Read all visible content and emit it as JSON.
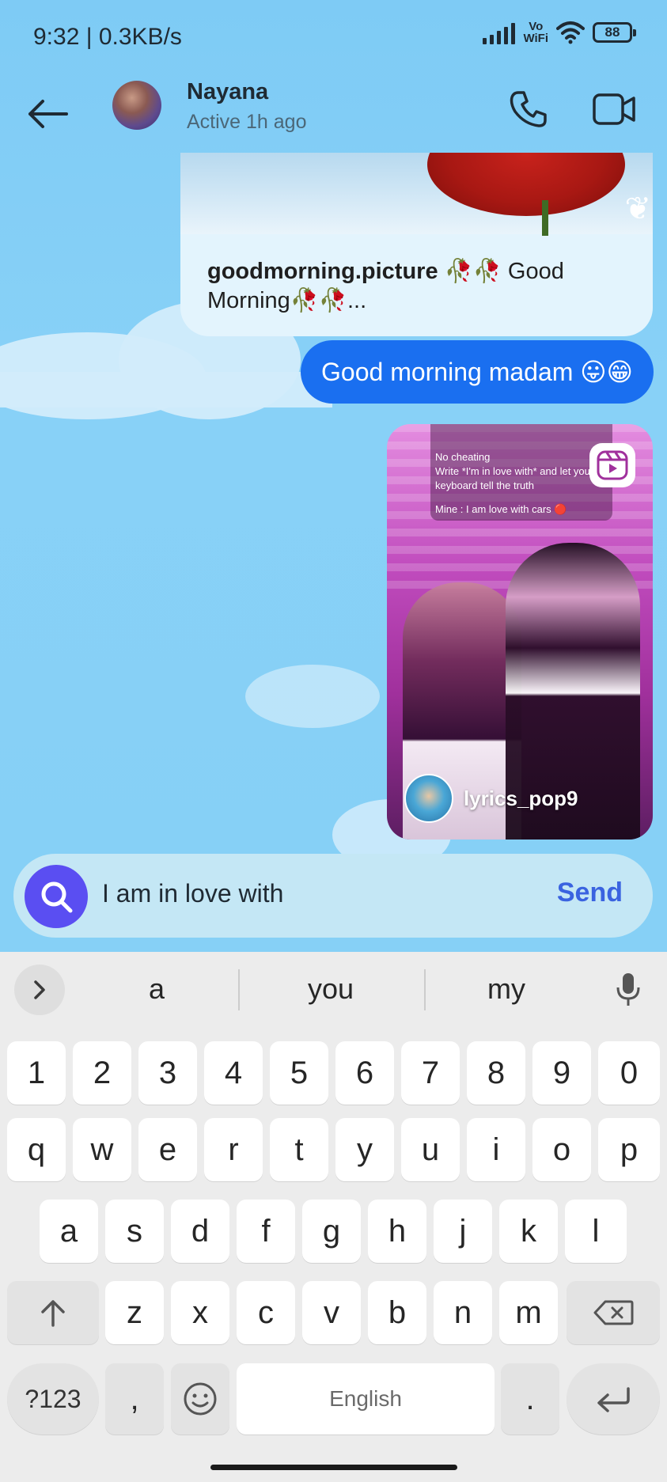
{
  "status_bar": {
    "time": "9:32 | 0.3KB/s",
    "network_label_top": "Vo",
    "network_label_bottom": "WiFi",
    "battery": "88"
  },
  "header": {
    "contact_name": "Nayana",
    "contact_status": "Active 1h ago"
  },
  "messages": {
    "shared_post": {
      "account": "goodmorning.picture",
      "caption": " 🥀🥀 Good Morning🥀🥀..."
    },
    "sent_text": "Good morning madam 😛😁",
    "shared_reel": {
      "author": "lyrics_pop9",
      "overlay_lines": [
        "No cheating",
        "Write *I'm in love with* and let your",
        "keyboard tell the truth",
        "",
        "Mine : I am love with cars 🔴"
      ]
    }
  },
  "composer": {
    "input_value": "I am in love with",
    "send_label": "Send"
  },
  "keyboard": {
    "suggestions": [
      "a",
      "you",
      "my"
    ],
    "number_row": [
      "1",
      "2",
      "3",
      "4",
      "5",
      "6",
      "7",
      "8",
      "9",
      "0"
    ],
    "row1": [
      "q",
      "w",
      "e",
      "r",
      "t",
      "y",
      "u",
      "i",
      "o",
      "p"
    ],
    "row2": [
      "a",
      "s",
      "d",
      "f",
      "g",
      "h",
      "j",
      "k",
      "l"
    ],
    "row3": [
      "z",
      "x",
      "c",
      "v",
      "b",
      "n",
      "m"
    ],
    "symbols_label": "?123",
    "comma_label": ",",
    "space_label": "English",
    "period_label": "."
  },
  "colors": {
    "sent_bubble": "#1a6ff0",
    "search_button": "#5a4ef2",
    "send_text": "#3a63e0"
  }
}
